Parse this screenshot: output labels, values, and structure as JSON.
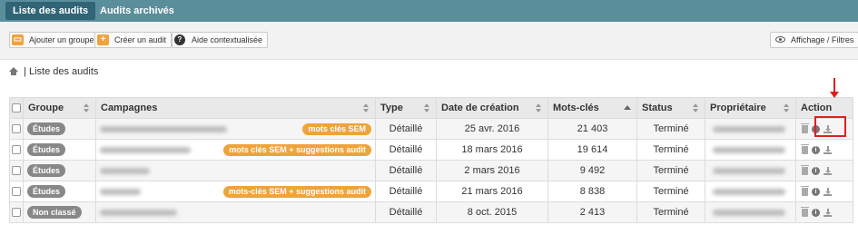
{
  "tabs": [
    {
      "label": "Liste des audits",
      "active": true
    },
    {
      "label": "Audits archivés",
      "active": false
    }
  ],
  "toolbar": {
    "add_group": "Ajouter un groupe",
    "create_audit": "Créer un audit",
    "help": "Aide contextualisée",
    "display_filters": "Affichage / Filtres"
  },
  "breadcrumb": "| Liste des audits",
  "table": {
    "headers": {
      "group": "Groupe",
      "campaigns": "Campagnes",
      "type": "Type",
      "created": "Date de création",
      "keywords": "Mots-clés",
      "status": "Status",
      "owner": "Propriétaire",
      "action": "Action"
    },
    "rows": [
      {
        "group": "Études",
        "tag": "mots clés SEM",
        "type": "Détaillé",
        "date": "25 avr. 2016",
        "keywords": "21 403",
        "status": "Terminé"
      },
      {
        "group": "Études",
        "tag": "mots clés SEM + suggestions audit",
        "type": "Détaillé",
        "date": "18 mars 2016",
        "keywords": "19 614",
        "status": "Terminé"
      },
      {
        "group": "Études",
        "tag": "",
        "type": "Détaillé",
        "date": "2 mars 2016",
        "keywords": "9 492",
        "status": "Terminé"
      },
      {
        "group": "Études",
        "tag": "mots-clés SEM + suggestions audit",
        "type": "Détaillé",
        "date": "21 mars 2016",
        "keywords": "8 838",
        "status": "Terminé"
      },
      {
        "group": "Non classé",
        "tag": "",
        "type": "Détaillé",
        "date": "8 oct. 2015",
        "keywords": "2 413",
        "status": "Terminé"
      }
    ]
  },
  "colors": {
    "topbar": "#5b8e9b",
    "active_tab": "#2f6577",
    "tag": "#f0a33a",
    "badge": "#888888",
    "annotation": "#e02020"
  },
  "icons": [
    "plus-square-icon",
    "plus-icon",
    "question-icon",
    "eye-icon",
    "home-icon",
    "sort-icon",
    "trash-icon",
    "info-icon",
    "download-icon"
  ]
}
